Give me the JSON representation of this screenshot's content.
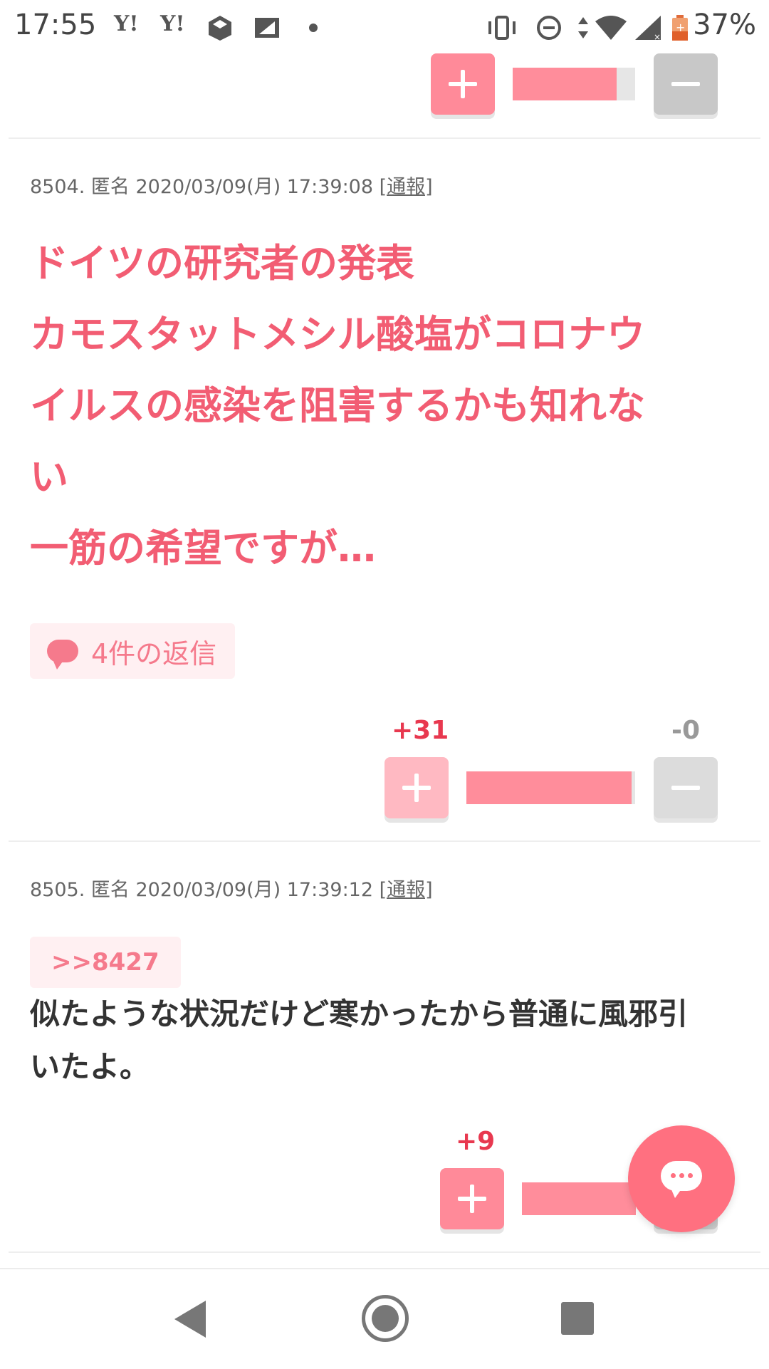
{
  "status_bar": {
    "time": "17:55",
    "notifications": [
      "Y!",
      "Y!"
    ],
    "battery": "37%"
  },
  "top_vote": {
    "plus_ratio": 0.85
  },
  "posts": [
    {
      "number": "8504.",
      "author": "匿名",
      "datetime": "2020/03/09(月) 17:39:08",
      "report_label": "[通報]",
      "body": "ドイツの研究者の発表\nカモスタットメシル酸塩がコロナウ\nイルスの感染を阻害するかも知れな\nい\n一筋の希望ですが…",
      "reply_label": "4件の返信",
      "plus_count": "+31",
      "minus_count": "-0",
      "plus_ratio": 0.98
    },
    {
      "number": "8505.",
      "author": "匿名",
      "datetime": "2020/03/09(月) 17:39:12",
      "report_label": "[通報]",
      "anchor": ">>8427",
      "body": "似たような状況だけど寒かったから普通に風邪引\nいたよ。",
      "plus_count": "+9"
    }
  ],
  "colors": {
    "accent": "#f25d73",
    "plus_button": "#ff8a99",
    "minus_button": "#c8c8c8",
    "fab": "#ff7080"
  },
  "icons": [
    "plus-icon",
    "minus-icon",
    "comment-bubble-icon",
    "chat-icon",
    "back-icon",
    "home-icon",
    "recents-icon"
  ]
}
